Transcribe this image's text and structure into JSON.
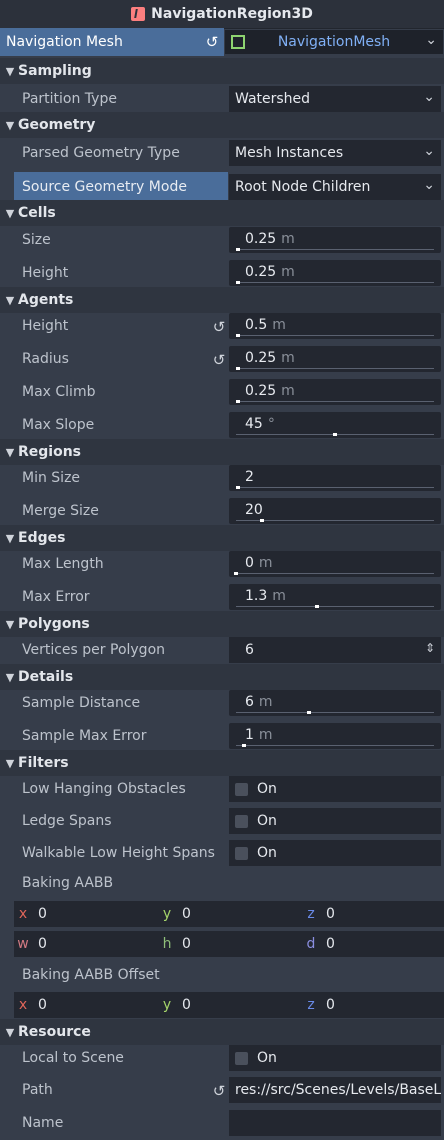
{
  "header": {
    "title": "NavigationRegion3D",
    "icon": "node-3d-icon"
  },
  "navigation_mesh": {
    "label": "Navigation Mesh",
    "value": "NavigationMesh"
  },
  "sections": {
    "sampling": "Sampling",
    "geometry": "Geometry",
    "cells": "Cells",
    "agents": "Agents",
    "regions": "Regions",
    "edges": "Edges",
    "polygons": "Polygons",
    "details": "Details",
    "filters": "Filters",
    "resource": "Resource"
  },
  "props": {
    "partition_type": {
      "label": "Partition Type",
      "value": "Watershed"
    },
    "parsed_geometry_type": {
      "label": "Parsed Geometry Type",
      "value": "Mesh Instances"
    },
    "source_geometry_mode": {
      "label": "Source Geometry Mode",
      "value": "Root Node Children"
    },
    "cell_size": {
      "label": "Size",
      "value": "0.25",
      "unit": "m"
    },
    "cell_height": {
      "label": "Height",
      "value": "0.25",
      "unit": "m"
    },
    "agent_height": {
      "label": "Height",
      "value": "0.5",
      "unit": "m"
    },
    "agent_radius": {
      "label": "Radius",
      "value": "0.25",
      "unit": "m"
    },
    "agent_max_climb": {
      "label": "Max Climb",
      "value": "0.25",
      "unit": "m"
    },
    "agent_max_slope": {
      "label": "Max Slope",
      "value": "45",
      "unit": "°",
      "slider_fraction": 0.5
    },
    "region_min_size": {
      "label": "Min Size",
      "value": "2",
      "slider_fraction": 0.01
    },
    "region_merge_size": {
      "label": "Merge Size",
      "value": "20",
      "slider_fraction": 0.13
    },
    "edge_max_length": {
      "label": "Max Length",
      "value": "0",
      "unit": "m",
      "slider_fraction": 0.0
    },
    "edge_max_error": {
      "label": "Max Error",
      "value": "1.3",
      "unit": "m",
      "slider_fraction": 0.41
    },
    "vertices_per_polygon": {
      "label": "Vertices per Polygon",
      "value": "6"
    },
    "detail_sample_distance": {
      "label": "Sample Distance",
      "value": "6",
      "unit": "m",
      "slider_fraction": 0.37
    },
    "detail_sample_max_error": {
      "label": "Sample Max Error",
      "value": "1",
      "unit": "m",
      "slider_fraction": 0.04
    },
    "low_hanging_obstacles": {
      "label": "Low Hanging Obstacles",
      "value": "On"
    },
    "ledge_spans": {
      "label": "Ledge Spans",
      "value": "On"
    },
    "walkable_low_height_spans": {
      "label": "Walkable Low Height Spans",
      "value": "On"
    },
    "baking_aabb": {
      "label": "Baking AABB",
      "x": "0",
      "y": "0",
      "z": "0",
      "w": "0",
      "h": "0",
      "d": "0"
    },
    "baking_aabb_offset": {
      "label": "Baking AABB Offset",
      "x": "0",
      "y": "0",
      "z": "0"
    },
    "local_to_scene": {
      "label": "Local to Scene",
      "value": "On"
    },
    "path": {
      "label": "Path",
      "value": "res://src/Scenes/Levels/BaseLe"
    },
    "name": {
      "label": "Name",
      "value": ""
    }
  },
  "axis_labels": {
    "x": "x",
    "y": "y",
    "z": "z",
    "w": "w",
    "h": "h",
    "d": "d"
  },
  "colors": {
    "panel_bg": "#363d4a",
    "field_bg": "#232730",
    "highlight": "#4a6d9a",
    "axis_x": "#e0665a",
    "axis_y": "#a4d46a",
    "axis_z": "#6a8be8",
    "resource_link": "#80b0f5"
  }
}
